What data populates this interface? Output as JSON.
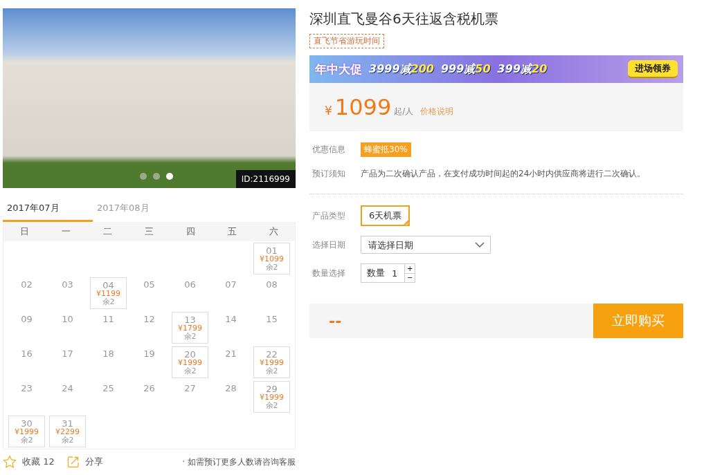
{
  "gallery": {
    "image_id": "ID:2116999",
    "slides": [
      {
        "selected": false
      },
      {
        "selected": false
      },
      {
        "selected": true
      }
    ]
  },
  "calendar": {
    "months": [
      {
        "label": "2017年07月",
        "selected": true
      },
      {
        "label": "2017年08月",
        "selected": false
      }
    ],
    "weekdays": [
      "日",
      "一",
      "二",
      "三",
      "四",
      "五",
      "六"
    ],
    "weeks": [
      [
        {
          "kind": "blank"
        },
        {
          "kind": "blank"
        },
        {
          "kind": "blank"
        },
        {
          "kind": "blank"
        },
        {
          "kind": "blank"
        },
        {
          "kind": "blank"
        },
        {
          "kind": "available",
          "day": "01",
          "price": "¥1099",
          "remaining": "余2"
        }
      ],
      [
        {
          "kind": "plain",
          "day": "02"
        },
        {
          "kind": "plain",
          "day": "03"
        },
        {
          "kind": "available",
          "day": "04",
          "price": "¥1199",
          "remaining": "余2"
        },
        {
          "kind": "plain",
          "day": "05"
        },
        {
          "kind": "plain",
          "day": "06"
        },
        {
          "kind": "plain",
          "day": "07"
        },
        {
          "kind": "plain",
          "day": "08"
        }
      ],
      [
        {
          "kind": "plain",
          "day": "09"
        },
        {
          "kind": "plain",
          "day": "10"
        },
        {
          "kind": "plain",
          "day": "11"
        },
        {
          "kind": "plain",
          "day": "12"
        },
        {
          "kind": "available",
          "day": "13",
          "price": "¥1799",
          "remaining": "余2"
        },
        {
          "kind": "plain",
          "day": "14"
        },
        {
          "kind": "plain",
          "day": "15"
        }
      ],
      [
        {
          "kind": "plain",
          "day": "16"
        },
        {
          "kind": "plain",
          "day": "17"
        },
        {
          "kind": "plain",
          "day": "18"
        },
        {
          "kind": "plain",
          "day": "19"
        },
        {
          "kind": "available",
          "day": "20",
          "price": "¥1999",
          "remaining": "余2"
        },
        {
          "kind": "plain",
          "day": "21"
        },
        {
          "kind": "available",
          "day": "22",
          "price": "¥1999",
          "remaining": "余2"
        }
      ],
      [
        {
          "kind": "plain",
          "day": "23"
        },
        {
          "kind": "plain",
          "day": "24"
        },
        {
          "kind": "plain",
          "day": "25"
        },
        {
          "kind": "plain",
          "day": "26"
        },
        {
          "kind": "plain",
          "day": "27"
        },
        {
          "kind": "plain",
          "day": "28"
        },
        {
          "kind": "available",
          "day": "29",
          "price": "¥1999",
          "remaining": "余2"
        }
      ],
      [
        {
          "kind": "available",
          "day": "30",
          "price": "¥1999",
          "remaining": "余2"
        },
        {
          "kind": "available",
          "day": "31",
          "price": "¥2299",
          "remaining": "余2"
        },
        {
          "kind": "blank"
        },
        {
          "kind": "blank"
        },
        {
          "kind": "blank"
        },
        {
          "kind": "blank"
        },
        {
          "kind": "blank"
        }
      ]
    ]
  },
  "footer": {
    "favorite": "收藏 12",
    "share": "分享",
    "note": "· 如需预订更多人数请咨询客服"
  },
  "product": {
    "title": "深圳直飞曼谷6天往返含税机票",
    "tag": "直飞节省游玩时间",
    "banner": {
      "headline": "年中大促",
      "offers": [
        {
          "threshold": "3999减",
          "discount": "200"
        },
        {
          "threshold": "999减",
          "discount": "50"
        },
        {
          "threshold": "399减",
          "discount": "20"
        }
      ],
      "button": "进场领券"
    },
    "price": {
      "currency": "¥",
      "amount": "1099",
      "unit": "起/人",
      "link": "价格说明"
    },
    "info": [
      {
        "label": "优惠信息",
        "kind": "badge",
        "value": "蜂蜜抵30%"
      },
      {
        "label": "预订须知",
        "kind": "text",
        "value": "产品为二次确认产品，在支付成功时间起的24小时内供应商将进行二次确认。"
      }
    ],
    "type": {
      "label": "产品类型",
      "options": [
        {
          "label": "6天机票",
          "selected": true
        }
      ]
    },
    "date": {
      "label": "选择日期",
      "placeholder": "请选择日期"
    },
    "quantity": {
      "label": "数量选择",
      "prefix": "数量",
      "value": "1",
      "plus": "+",
      "minus": "−"
    },
    "total": "--",
    "buy_button": "立即购买"
  }
}
